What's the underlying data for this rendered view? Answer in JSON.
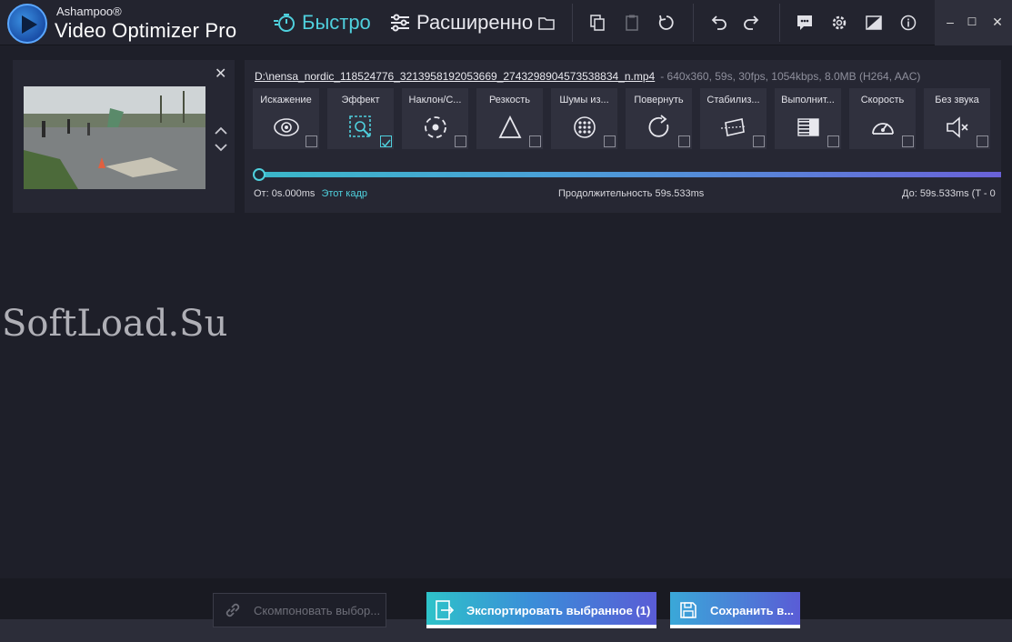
{
  "app": {
    "brand_top": "Ashampoo®",
    "brand_name": "Video Optimizer Pro"
  },
  "toolbar": {
    "mode_fast": "Быстро",
    "mode_advanced": "Расширенно",
    "icons": [
      "folder-icon",
      "copy-icon",
      "paste-icon",
      "reset-icon",
      "undo-icon",
      "redo-icon",
      "feedback-icon",
      "settings-icon",
      "display-icon",
      "info-icon"
    ]
  },
  "window": {
    "minimize": "–",
    "maximize": "☐",
    "close": "✕"
  },
  "clip": {
    "file_path": "D:\\nensa_nordic_118524776_3213958192053669_2743298904573538834_n.mp4",
    "file_meta": "-   640x360, 59s, 30fps, 1054kbps, 8.0MB (H264, AAC)"
  },
  "tools": [
    {
      "label": "Искажение",
      "icon": "eye-icon",
      "checked": false
    },
    {
      "label": "Эффект",
      "icon": "effect-icon",
      "checked": true
    },
    {
      "label": "Наклон/С...",
      "icon": "tilt-icon",
      "checked": false
    },
    {
      "label": "Резкость",
      "icon": "sharpness-icon",
      "checked": false
    },
    {
      "label": "Шумы из...",
      "icon": "noise-icon",
      "checked": false
    },
    {
      "label": "Повернуть",
      "icon": "rotate-icon",
      "checked": false
    },
    {
      "label": "Стабилиз...",
      "icon": "stabilize-icon",
      "checked": false
    },
    {
      "label": "Выполнит...",
      "icon": "execute-icon",
      "checked": false
    },
    {
      "label": "Скорость",
      "icon": "speed-icon",
      "checked": false
    },
    {
      "label": "Без звука",
      "icon": "mute-icon",
      "checked": false
    }
  ],
  "timeline": {
    "from_label": "От:",
    "from_value": "0s.000ms",
    "this_frame": "Этот кадр",
    "duration_label": "Продолжительность",
    "duration_value": "59s.533ms",
    "to_label": "До:",
    "to_value": "59s.533ms (T - 0"
  },
  "watermark": "SoftLoad.Su",
  "actions": {
    "combine": "Скомпоновать выбор...",
    "export": "Экспортировать выбранное (1)",
    "save": "Сохранить в..."
  }
}
